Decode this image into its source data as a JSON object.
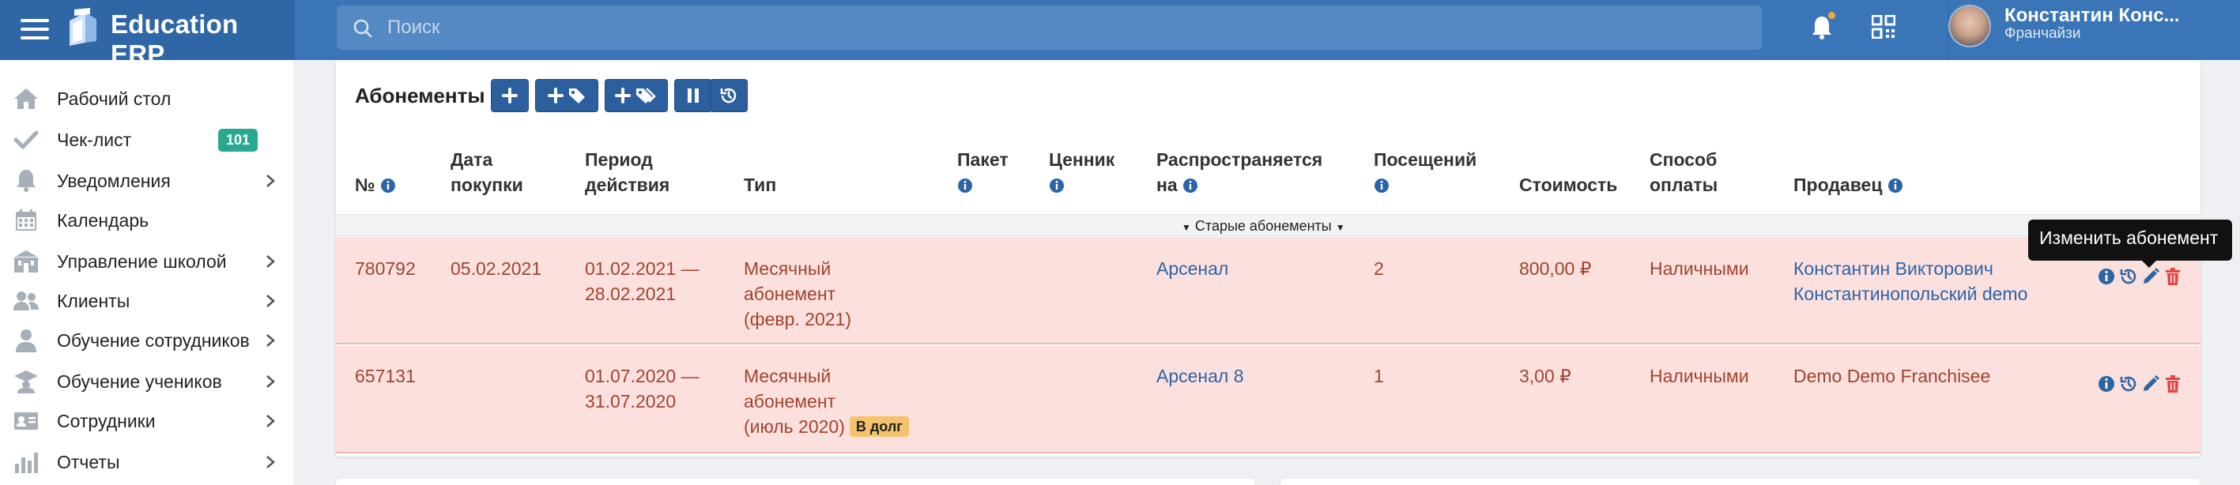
{
  "header": {
    "app_name": "Education ERP",
    "search_placeholder": "Поиск",
    "user_name": "Константин Конс...",
    "user_role": "Франчайзи"
  },
  "sidebar": {
    "items": [
      {
        "label": "Рабочий стол",
        "icon": "home-icon"
      },
      {
        "label": "Чек-лист",
        "icon": "check-icon",
        "badge": "101"
      },
      {
        "label": "Уведомления",
        "icon": "bell-icon"
      },
      {
        "label": "Календарь",
        "icon": "calendar-icon"
      },
      {
        "label": "Управление школой",
        "icon": "school-icon"
      },
      {
        "label": "Клиенты",
        "icon": "users-icon"
      },
      {
        "label": "Обучение сотрудников",
        "icon": "teacher-icon"
      },
      {
        "label": "Обучение учеников",
        "icon": "graduation-icon"
      },
      {
        "label": "Сотрудники",
        "icon": "id-card-icon"
      },
      {
        "label": "Отчеты",
        "icon": "chart-icon"
      }
    ]
  },
  "section": {
    "title": "Абонементы"
  },
  "table": {
    "columns": {
      "number": "№",
      "purchase_date_1": "Дата",
      "purchase_date_2": "покупки",
      "period_1": "Период",
      "period_2": "действия",
      "type": "Тип",
      "package": "Пакет",
      "pricelist": "Ценник",
      "applies_1": "Распространяется",
      "applies_2": "на",
      "visits": "Посещений",
      "cost": "Стоимость",
      "payment_1": "Способ",
      "payment_2": "оплаты",
      "seller": "Продавец"
    },
    "group_label": "Старые абонементы",
    "rows": [
      {
        "number": "780792",
        "purchase_date": "05.02.2021",
        "period_1": "01.02.2021 —",
        "period_2": "28.02.2021",
        "type_1": "Месячный",
        "type_2": "абонемент",
        "type_3": "(февр. 2021)",
        "type_badge": "",
        "applies_to": "Арсенал",
        "visits": "2",
        "cost": "800,00 ₽",
        "payment": "Наличными",
        "seller_1": "Константин Викторович",
        "seller_2": "Константинопольский demo"
      },
      {
        "number": "657131",
        "purchase_date": "",
        "period_1": "01.07.2020 —",
        "period_2": "31.07.2020",
        "type_1": "Месячный",
        "type_2": "абонемент",
        "type_3": "(июль 2020)",
        "type_badge": "В долг",
        "applies_to": "Арсенал 8",
        "visits": "1",
        "cost": "3,00 ₽",
        "payment": "Наличными",
        "seller_1": "Demo Demo Franchisee",
        "seller_2": ""
      }
    ]
  },
  "tooltip": {
    "text": "Изменить абонемент"
  },
  "colors": {
    "header_bg": "#3a75b7",
    "brand_bg": "#2f66a6",
    "button_bg": "#2b5f9e",
    "row_bg": "#fce0de",
    "row_text": "#a0442f",
    "link": "#2b65a6",
    "badge_green": "#2aa88f",
    "badge_debt": "#f4c36c",
    "delete_red": "#e04848"
  }
}
